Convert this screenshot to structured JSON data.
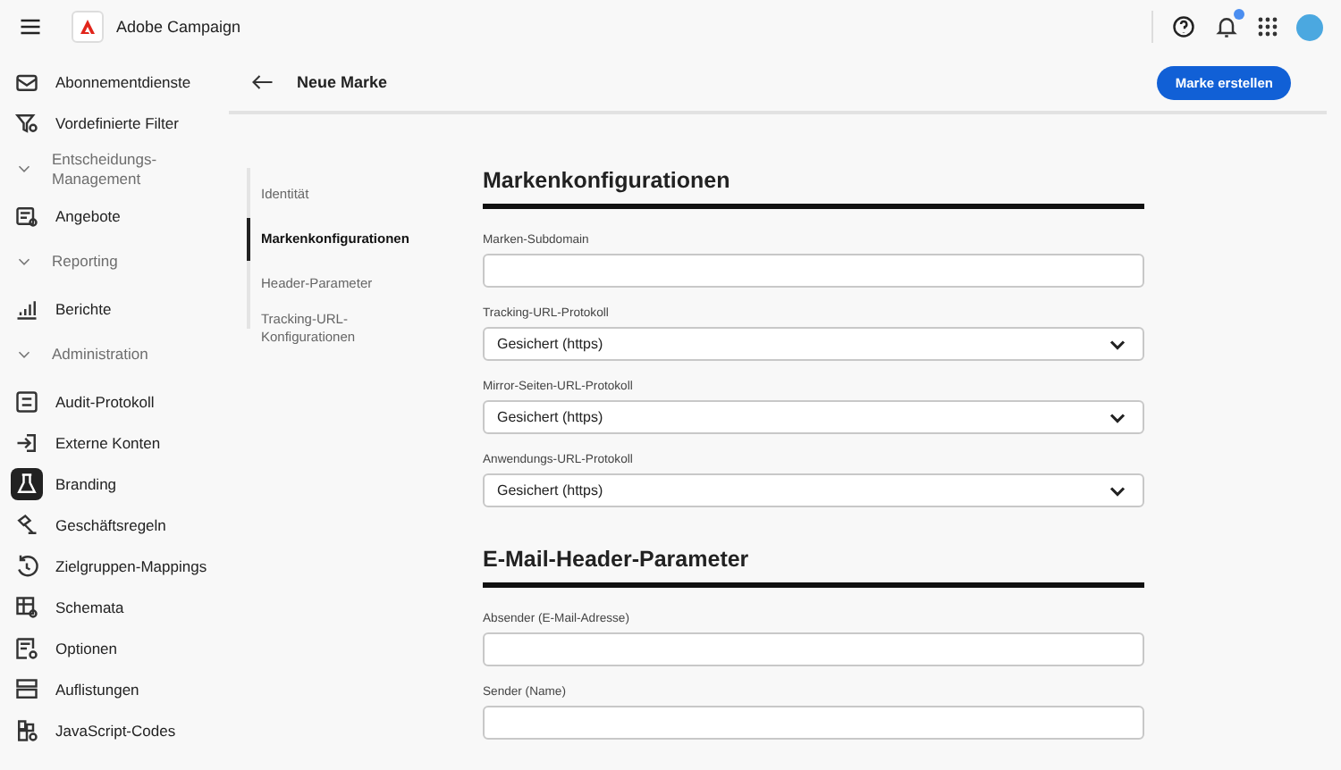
{
  "app": {
    "title": "Adobe Campaign"
  },
  "sidebar": {
    "items": [
      {
        "kind": "item",
        "label": "Abonnementdienste",
        "selected": false
      },
      {
        "kind": "item",
        "label": "Vordefinierte Filter",
        "selected": false
      },
      {
        "kind": "section",
        "label": "Entscheidungs-Management",
        "expanded": true
      },
      {
        "kind": "item",
        "label": "Angebote",
        "selected": false
      },
      {
        "kind": "section",
        "label": "Reporting",
        "expanded": true
      },
      {
        "kind": "item",
        "label": "Berichte",
        "selected": false
      },
      {
        "kind": "section",
        "label": "Administration",
        "expanded": true
      },
      {
        "kind": "item",
        "label": "Audit-Protokoll",
        "selected": false
      },
      {
        "kind": "item",
        "label": "Externe Konten",
        "selected": false
      },
      {
        "kind": "item",
        "label": "Branding",
        "selected": true
      },
      {
        "kind": "item",
        "label": "Geschäftsregeln",
        "selected": false
      },
      {
        "kind": "item",
        "label": "Zielgruppen-Mappings",
        "selected": false
      },
      {
        "kind": "item",
        "label": "Schemata",
        "selected": false
      },
      {
        "kind": "item",
        "label": "Optionen",
        "selected": false
      },
      {
        "kind": "item",
        "label": "Auflistungen",
        "selected": false
      },
      {
        "kind": "item",
        "label": "JavaScript-Codes",
        "selected": false
      }
    ]
  },
  "page": {
    "title": "Neue Marke",
    "primary_button": "Marke erstellen"
  },
  "section_nav": [
    {
      "label": "Identität",
      "selected": false
    },
    {
      "label": "Markenkonfigurationen",
      "selected": true
    },
    {
      "label": "Header-Parameter",
      "selected": false
    },
    {
      "label": "Tracking-URL-Konfigurationen",
      "selected": false
    }
  ],
  "sections": [
    {
      "heading": "Markenkonfigurationen",
      "fields": [
        {
          "kind": "text",
          "label": "Marken-Subdomain"
        },
        {
          "kind": "select",
          "label": "Tracking-URL-Protokoll",
          "value": "Gesichert (https)"
        },
        {
          "kind": "select",
          "label": "Mirror-Seiten-URL-Protokoll",
          "value": "Gesichert (https)"
        },
        {
          "kind": "select",
          "label": "Anwendungs-URL-Protokoll",
          "value": "Gesichert (https)"
        }
      ]
    },
    {
      "heading": "E-Mail-Header-Parameter",
      "fields": [
        {
          "kind": "text",
          "label": "Absender (E-Mail-Adresse)"
        },
        {
          "kind": "text",
          "label": "Sender (Name)"
        }
      ]
    }
  ]
}
